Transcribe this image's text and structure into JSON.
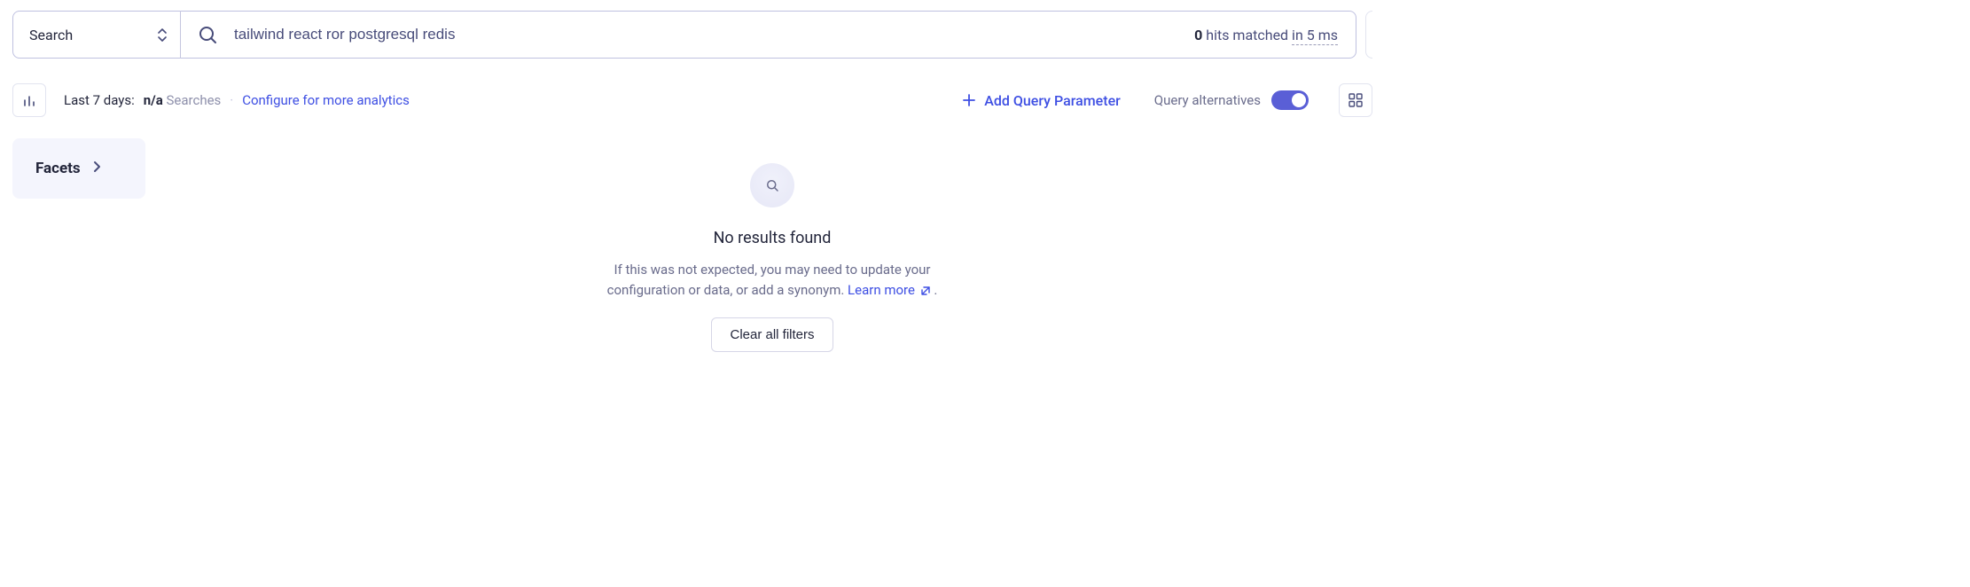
{
  "search": {
    "mode_label": "Search",
    "query": "tailwind react ror postgresql redis",
    "hits_count": "0",
    "hits_matched_label": "hits matched",
    "hits_prefix": "in",
    "hits_duration": "5 ms"
  },
  "toolbar": {
    "period_label": "Last 7 days:",
    "na_value": "n/a",
    "searches_label": "Searches",
    "configure_label": "Configure for more analytics",
    "add_query_label": "Add Query Parameter",
    "query_alt_label": "Query alternatives"
  },
  "facets": {
    "title": "Facets"
  },
  "empty": {
    "title": "No results found",
    "subtitle_1": "If this was not expected, you may need to update your",
    "subtitle_2": "configuration or data, or add a synonym.",
    "learn_more": "Learn more",
    "period": ".",
    "clear_label": "Clear all filters"
  }
}
